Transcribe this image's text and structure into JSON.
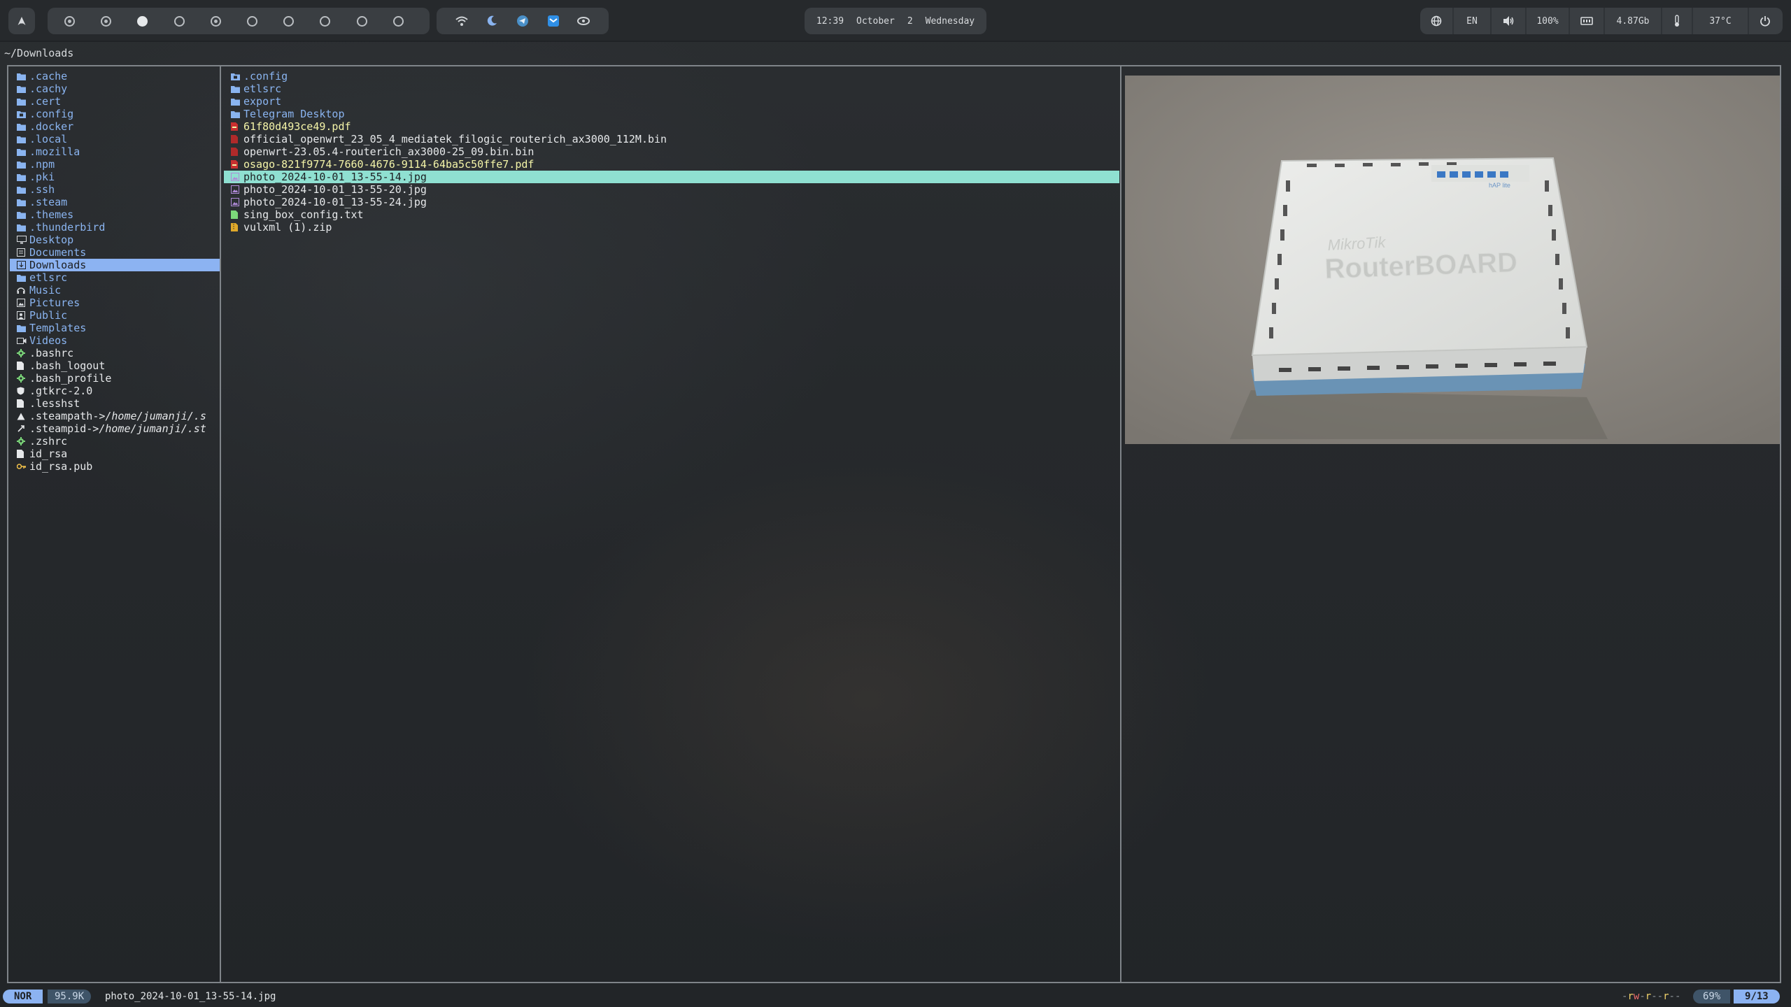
{
  "topbar": {
    "workspaces": [
      {
        "id": "ws-1",
        "state": "occupied"
      },
      {
        "id": "ws-2",
        "state": "occupied"
      },
      {
        "id": "ws-3",
        "state": "current"
      },
      {
        "id": "ws-4",
        "state": "empty"
      },
      {
        "id": "ws-5",
        "state": "occupied"
      },
      {
        "id": "ws-6",
        "state": "empty"
      },
      {
        "id": "ws-7",
        "state": "empty"
      },
      {
        "id": "ws-8",
        "state": "empty"
      },
      {
        "id": "ws-9",
        "state": "empty"
      },
      {
        "id": "ws-10",
        "state": "empty"
      }
    ],
    "tray_icons": [
      "wifi-icon",
      "bluetooth-moon-icon",
      "telegram-icon",
      "mail-icon",
      "eye-icon"
    ],
    "clock": {
      "time": "12:39",
      "month": "October",
      "day": "2",
      "weekday": "Wednesday"
    },
    "status": {
      "globe_icon": "globe-icon",
      "layout": "EN",
      "volume_icon": "volume-icon",
      "volume": "100%",
      "memory_icon": "memory-icon",
      "memory": "4.87Gb",
      "temp_icon": "thermometer-icon",
      "temperature": "37°C",
      "power_icon": "power-icon"
    }
  },
  "path": "~/Downloads",
  "left_pane": {
    "items": [
      {
        "name": ".cache",
        "kind": "dir"
      },
      {
        "name": ".cachy",
        "kind": "dir"
      },
      {
        "name": ".cert",
        "kind": "dir"
      },
      {
        "name": ".config",
        "kind": "dirbox"
      },
      {
        "name": ".docker",
        "kind": "dir"
      },
      {
        "name": ".local",
        "kind": "dir"
      },
      {
        "name": ".mozilla",
        "kind": "dir"
      },
      {
        "name": ".npm",
        "kind": "dir"
      },
      {
        "name": ".pki",
        "kind": "dir"
      },
      {
        "name": ".ssh",
        "kind": "dir"
      },
      {
        "name": ".steam",
        "kind": "dir"
      },
      {
        "name": ".themes",
        "kind": "dir"
      },
      {
        "name": ".thunderbird",
        "kind": "dir"
      },
      {
        "name": "Desktop",
        "kind": "desktop"
      },
      {
        "name": "Documents",
        "kind": "docs"
      },
      {
        "name": "Downloads",
        "kind": "downloads",
        "selected": true
      },
      {
        "name": "etlsrc",
        "kind": "dir"
      },
      {
        "name": "Music",
        "kind": "music"
      },
      {
        "name": "Pictures",
        "kind": "pictures"
      },
      {
        "name": "Public",
        "kind": "public"
      },
      {
        "name": "Templates",
        "kind": "dir"
      },
      {
        "name": "Videos",
        "kind": "videos"
      },
      {
        "name": ".bashrc",
        "kind": "gear"
      },
      {
        "name": ".bash_logout",
        "kind": "file"
      },
      {
        "name": ".bash_profile",
        "kind": "gear"
      },
      {
        "name": ".gtkrc-2.0",
        "kind": "shield"
      },
      {
        "name": ".lesshst",
        "kind": "file"
      },
      {
        "name": ".steampath",
        "link": "/home/jumanji/.s",
        "kind": "warn"
      },
      {
        "name": ".steampid",
        "link": "/home/jumanji/.st",
        "kind": "link"
      },
      {
        "name": ".zshrc",
        "kind": "gear"
      },
      {
        "name": "id_rsa",
        "kind": "file"
      },
      {
        "name": "id_rsa.pub",
        "kind": "key"
      }
    ]
  },
  "middle_pane": {
    "items": [
      {
        "name": ".config",
        "kind": "dirbox"
      },
      {
        "name": "etlsrc",
        "kind": "dir"
      },
      {
        "name": "export",
        "kind": "dir"
      },
      {
        "name": "Telegram Desktop",
        "kind": "dir"
      },
      {
        "name": "61f80d493ce49.pdf",
        "kind": "pdf"
      },
      {
        "name": "official_openwrt_23_05_4_mediatek_filogic_routerich_ax3000_112M.bin",
        "kind": "bin"
      },
      {
        "name": "openwrt-23.05.4-routerich_ax3000-25_09.bin.bin",
        "kind": "bin"
      },
      {
        "name": "osago-821f9774-7660-4676-9114-64ba5c50ffe7.pdf",
        "kind": "pdf"
      },
      {
        "name": "photo_2024-10-01_13-55-14.jpg",
        "kind": "img",
        "selected": true
      },
      {
        "name": "photo_2024-10-01_13-55-20.jpg",
        "kind": "img"
      },
      {
        "name": "photo_2024-10-01_13-55-24.jpg",
        "kind": "img"
      },
      {
        "name": "sing_box_config.txt",
        "kind": "txt"
      },
      {
        "name": "vulxml (1).zip",
        "kind": "zip"
      }
    ]
  },
  "preview": {
    "brand_small": "MikroTik",
    "brand_large": "RouterBOARD",
    "model_badge": "hAP lite"
  },
  "statusline": {
    "mode": "NOR",
    "size": "95.9K",
    "filename": "photo_2024-10-01_13-55-14.jpg",
    "permissions": "-rw-r--r--",
    "percent": "69%",
    "position": "9/13"
  }
}
